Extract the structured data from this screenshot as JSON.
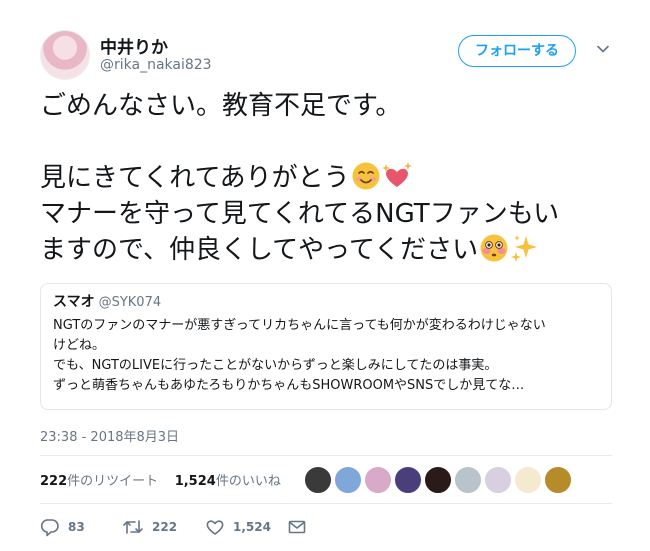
{
  "user": {
    "display_name": "中井りか",
    "screen_name": "@rika_nakai823",
    "avatar_icon": "profile-photo"
  },
  "follow_button": {
    "label": "フォローする",
    "color": "#1da1f2"
  },
  "menu_icon": "chevron-down-icon",
  "tweet": {
    "lines": [
      "ごめんなさい。教育不足です。",
      "",
      "見にきてくれてありがとう",
      "マナーを守って見てくれてるNGTファンもい",
      "ますので、仲良くしてやってください"
    ],
    "emojis_line3": [
      "smiling-face-icon",
      "sparkling-heart-icon"
    ],
    "emojis_line5": [
      "flushed-face-icon",
      "sparkles-icon"
    ]
  },
  "quoted_tweet": {
    "name": "スマオ",
    "handle": "@SYK074",
    "lines": [
      "NGTのファンのマナーが悪すぎってリカちゃんに言っても何かが変わるわけじゃない",
      "けどね。",
      "でも、NGTのLIVEに行ったことがないからずっと楽しみにしてたのは事実。",
      "ずっと萌香ちゃんもあゆたろもりかちゃんもSHOWROOMやSNSでしか見てな…"
    ]
  },
  "timestamp": "23:38 - 2018年8月3日",
  "stats": {
    "retweets_count": "222",
    "retweets_label": "件のリツイート",
    "likes_count": "1,524",
    "likes_label": "件のいいね"
  },
  "likers": [
    {
      "icon": "user-avatar-1",
      "color": "#3a3a3a"
    },
    {
      "icon": "user-avatar-2",
      "color": "#7fa7d9"
    },
    {
      "icon": "user-avatar-3",
      "color": "#d9a9c9"
    },
    {
      "icon": "user-avatar-4",
      "color": "#4a3f7a"
    },
    {
      "icon": "user-avatar-5",
      "color": "#2a1a1a"
    },
    {
      "icon": "user-avatar-6",
      "color": "#b9c3cc"
    },
    {
      "icon": "user-avatar-7",
      "color": "#d8cfe0"
    },
    {
      "icon": "user-avatar-8",
      "color": "#f3ead0"
    },
    {
      "icon": "user-avatar-9",
      "color": "#b78a2a"
    }
  ],
  "actions": {
    "replies": "83",
    "retweets": "222",
    "likes": "1,524"
  }
}
